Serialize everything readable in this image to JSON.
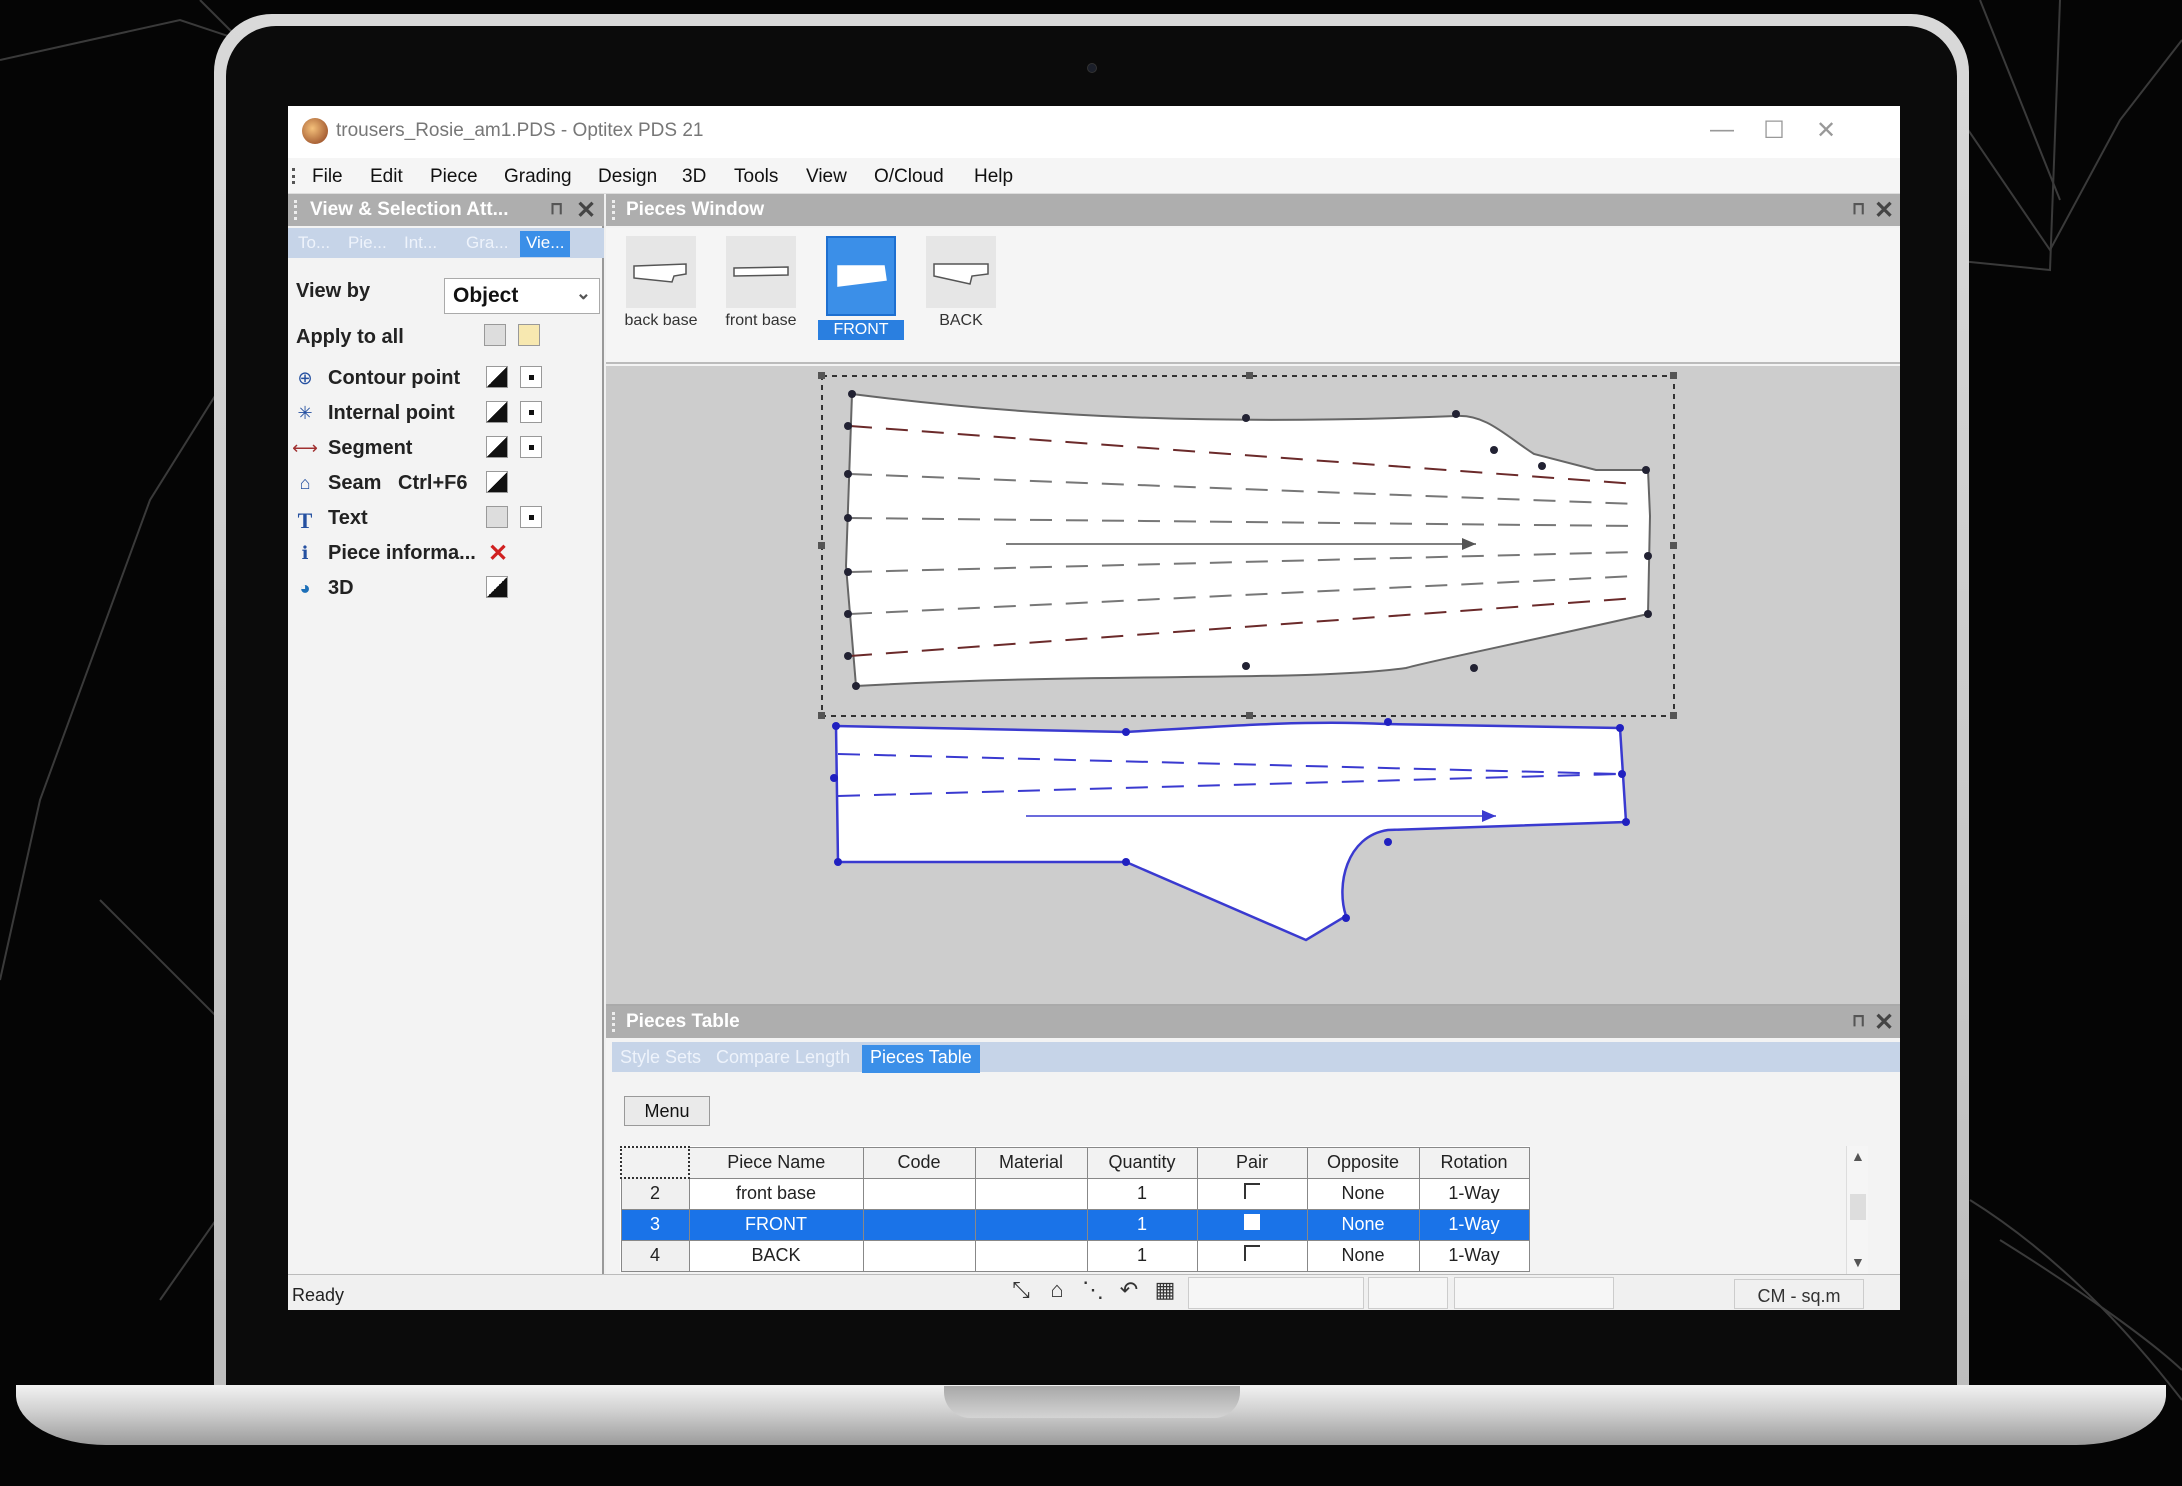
{
  "window": {
    "title": "trousers_Rosie_am1.PDS - Optitex PDS 21",
    "minimize": "—",
    "maximize": "☐",
    "close": "✕"
  },
  "menu": [
    "File",
    "Edit",
    "Piece",
    "Grading",
    "Design",
    "3D",
    "Tools",
    "View",
    "O/Cloud",
    "Help"
  ],
  "left_panel": {
    "title": "View & Selection Att...",
    "pin": "⊓",
    "close": "✕",
    "tabs": [
      {
        "label": "To..."
      },
      {
        "label": "Pie..."
      },
      {
        "label": "Int..."
      },
      {
        "label": "Gra..."
      },
      {
        "label": "Vie...",
        "active": true
      }
    ],
    "view_by_label": "View by",
    "view_by_value": "Object",
    "apply_to_all_label": "Apply to all",
    "rows": [
      {
        "label": "Contour point",
        "icon": "contour-point-icon"
      },
      {
        "label": "Internal point",
        "icon": "internal-point-icon"
      },
      {
        "label": "Segment",
        "icon": "segment-icon"
      },
      {
        "label": "Seam   Ctrl+F6",
        "icon": "seam-icon"
      },
      {
        "label": "Text",
        "icon": "text-icon"
      },
      {
        "label": "Piece informa...",
        "icon": "piece-info-icon"
      },
      {
        "label": "3D",
        "icon": "3d-icon"
      }
    ]
  },
  "pieces_window": {
    "title": "Pieces Window",
    "pin": "⊓",
    "close": "✕",
    "pieces": [
      {
        "label": "back base"
      },
      {
        "label": "front base"
      },
      {
        "label": "FRONT",
        "selected": true
      },
      {
        "label": "BACK"
      }
    ]
  },
  "pieces_table": {
    "title": "Pieces Table",
    "pin": "⊓",
    "close": "✕",
    "tabs": [
      "Style Sets",
      "Compare Length",
      "Pieces Table"
    ],
    "active_tab": "Pieces Table",
    "menu_button": "Menu",
    "columns": [
      "",
      "Piece Name",
      "Code",
      "Material",
      "Quantity",
      "Pair",
      "Opposite",
      "Rotation"
    ],
    "rows": [
      {
        "no": "2",
        "name": "front base",
        "code": "",
        "material": "",
        "quantity": "1",
        "opposite": "None",
        "rotation": "1-Way",
        "selected": false
      },
      {
        "no": "3",
        "name": "FRONT",
        "code": "",
        "material": "",
        "quantity": "1",
        "opposite": "None",
        "rotation": "1-Way",
        "selected": true
      },
      {
        "no": "4",
        "name": "BACK",
        "code": "",
        "material": "",
        "quantity": "1",
        "opposite": "None",
        "rotation": "1-Way",
        "selected": false
      }
    ]
  },
  "status": {
    "text": "Ready",
    "units": "CM - sq.m"
  },
  "colors": {
    "selection_blue": "#1a73e8",
    "front_piece_outline": "#3a3ad0",
    "back_piece_dash": "#6b2a2a"
  }
}
